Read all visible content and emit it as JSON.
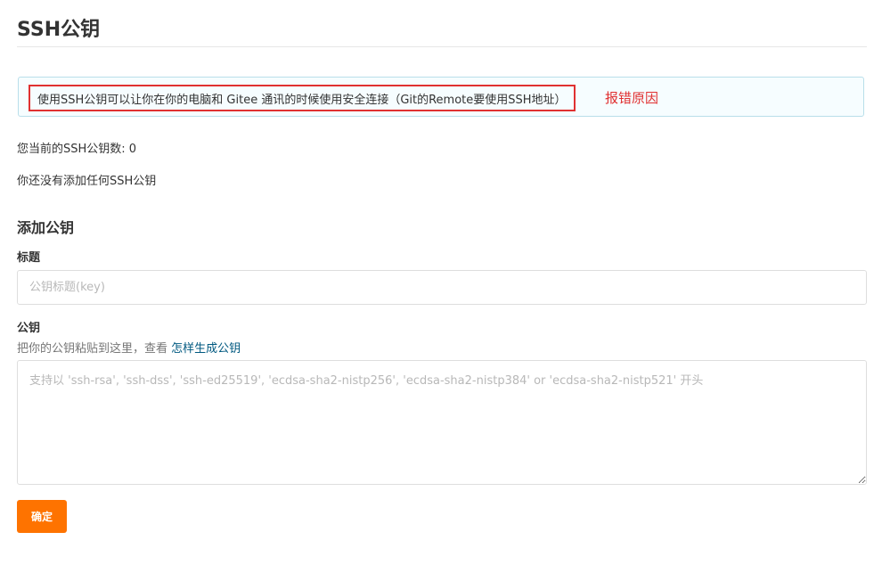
{
  "page": {
    "title": "SSH公钥"
  },
  "info": {
    "message": "使用SSH公钥可以让你在你的电脑和 Gitee 通讯的时候使用安全连接（Git的Remote要使用SSH地址）",
    "annotation": "报错原因"
  },
  "status": {
    "key_count_label": "您当前的SSH公钥数: 0",
    "empty_message": "你还没有添加任何SSH公钥"
  },
  "add_key": {
    "heading": "添加公钥",
    "title_label": "标题",
    "title_placeholder": "公钥标题(key)",
    "title_value": "",
    "key_label": "公钥",
    "key_hint": "把你的公钥粘贴到这里，查看 ",
    "key_hint_link": "怎样生成公钥",
    "key_placeholder": "支持以 'ssh-rsa', 'ssh-dss', 'ssh-ed25519', 'ecdsa-sha2-nistp256', 'ecdsa-sha2-nistp384' or 'ecdsa-sha2-nistp521' 开头",
    "key_value": "",
    "confirm_label": "确定"
  },
  "colors": {
    "accent": "#fe7300",
    "annotation": "#e03131",
    "link": "#005980",
    "info_bg": "#f6fdff",
    "info_border": "#b9dfea"
  }
}
